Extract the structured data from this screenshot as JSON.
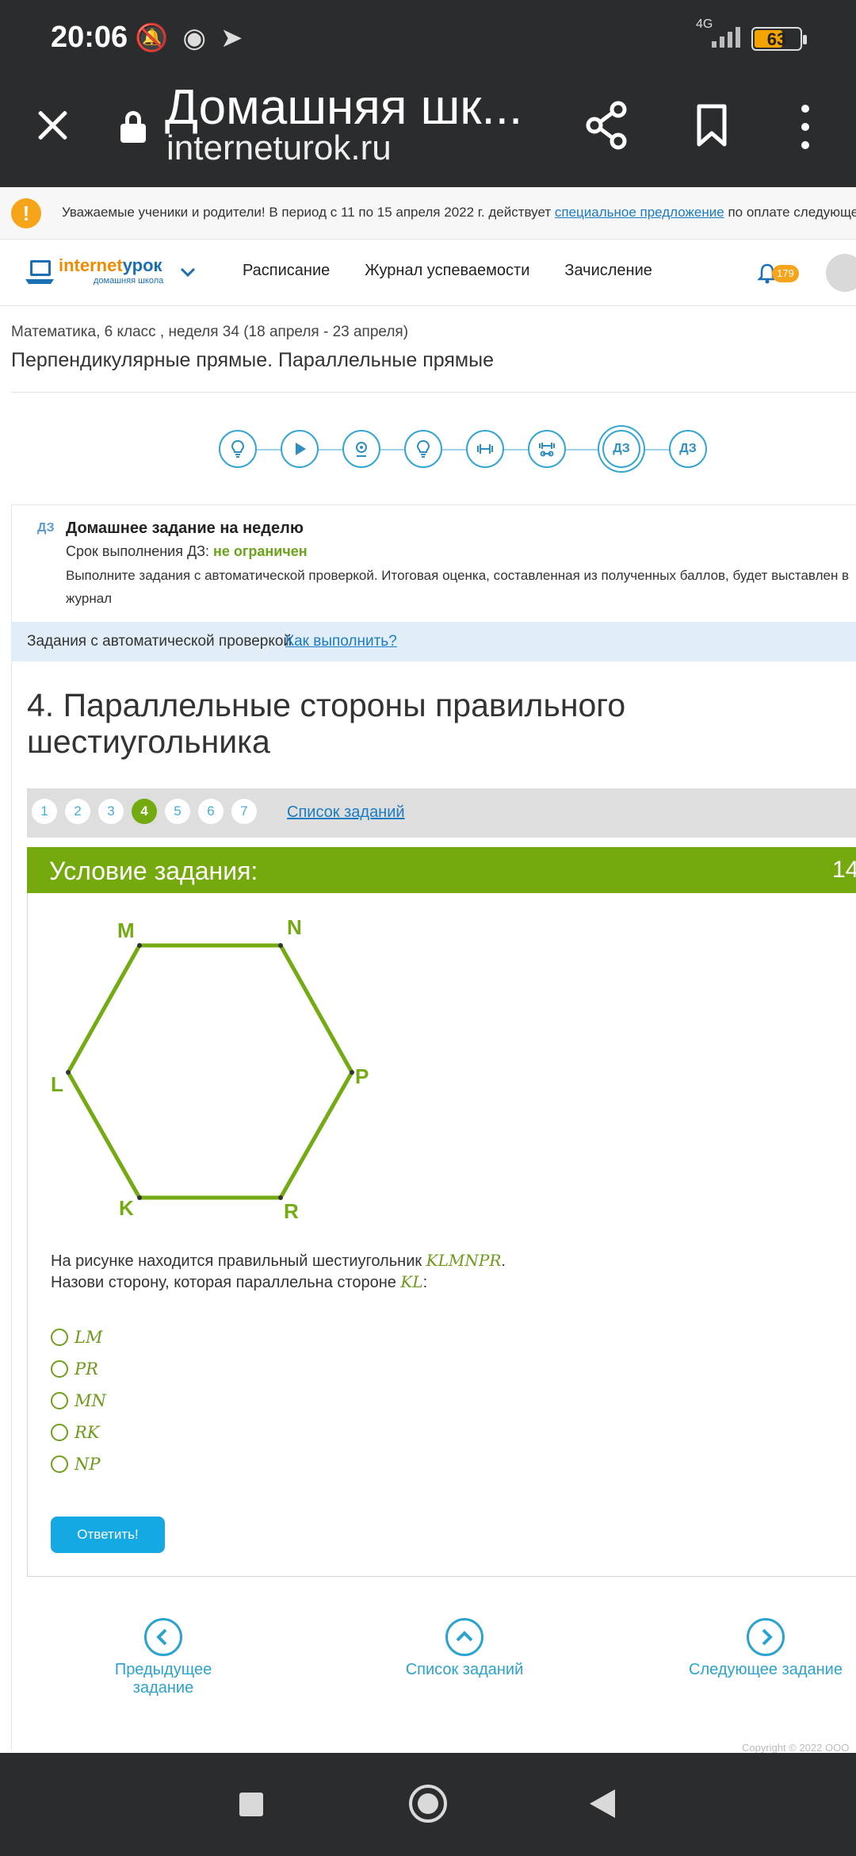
{
  "status_bar": {
    "time": "20:06",
    "network": "4G",
    "battery": "63",
    "battery_level": 0.63
  },
  "browser": {
    "title": "Домашняя шк...",
    "url": "interneturok.ru"
  },
  "announcement": {
    "before": "Уважаемые ученики и родители! В период с 11 по 15 апреля 2022 г. действует ",
    "link": "специальное предложение",
    "after": " по оплате следующего учебного"
  },
  "header": {
    "logo_primary": "internet",
    "logo_accent": "урок",
    "logo_sub": "домашняя школа",
    "nav": [
      "Расписание",
      "Журнал успеваемости",
      "Зачисление"
    ],
    "notifications": "179"
  },
  "breadcrumb": "Математика, 6 класс , неделя 34 (18 апреля - 23 апреля)",
  "lesson_title": "Перпендикулярные прямые. Параллельные прямые",
  "steps": [
    {
      "icon": "lightbulb-icon"
    },
    {
      "icon": "play-icon"
    },
    {
      "icon": "webcam-icon"
    },
    {
      "icon": "lightbulb-icon"
    },
    {
      "icon": "dumbbell-icon"
    },
    {
      "icon": "dumbbell-stack-icon"
    },
    {
      "label": "ДЗ",
      "active": true
    },
    {
      "label": "ДЗ"
    }
  ],
  "homework": {
    "tag": "ДЗ",
    "title": "Домашнее задание на неделю",
    "deadline_label": "Срок выполнения ДЗ: ",
    "deadline_value": "не ограничен",
    "description": "Выполните задания с автоматической проверкой. Итоговая оценка, составленная из полученных баллов, будет выставлен в журнал"
  },
  "autocheck": {
    "label": "Задания с автоматической проверкой",
    "link": "Как выполнить?"
  },
  "task": {
    "heading": "4. Параллельные стороны правильного шестиугольника",
    "pages": [
      "1",
      "2",
      "3",
      "4",
      "5",
      "6",
      "7"
    ],
    "active_page": "4",
    "task_list_link": "Список заданий",
    "condition_title": "Условие задания:",
    "condition_points": "14",
    "vertices": [
      "M",
      "N",
      "P",
      "R",
      "K",
      "L"
    ],
    "question_line1": "На рисунке находится правильный шестиугольник ",
    "hexagon_name": "KLMNPR",
    "question_line2": "Назови сторону, которая параллельна стороне ",
    "side_name": "KL",
    "options": [
      "LM",
      "PR",
      "MN",
      "RK",
      "NP"
    ],
    "submit": "Ответить!"
  },
  "bottom_nav": {
    "prev": "Предыдущее задание",
    "list": "Список заданий",
    "next": "Следующее задание"
  },
  "copyright": "Copyright © 2022 ООО",
  "colors": {
    "accent_green": "#75aa0f",
    "link_blue": "#1b7cc2",
    "button_blue": "#14a9e3",
    "badge_orange": "#f6a51b"
  }
}
